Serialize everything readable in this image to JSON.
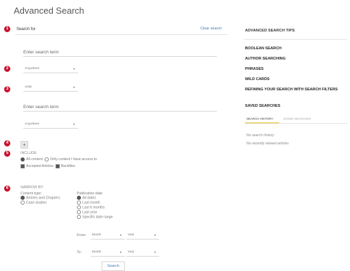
{
  "page": {
    "title": "Advanced Search"
  },
  "badges": [
    "1",
    "2",
    "3",
    "4",
    "5",
    "6"
  ],
  "search": {
    "search_for_label": "Search for",
    "clear_label": "Clear search",
    "term_placeholder": "Enter search term",
    "field_select": "Anywhere",
    "operator_select": "AND",
    "term2_placeholder": "Enter search term",
    "field2_select": "Anywhere"
  },
  "include": {
    "label": "INCLUDE:",
    "all_content": "All content",
    "only_access": "Only content I have access to",
    "accepted_articles": "Accepted Articles",
    "backfiles": "Backfiles"
  },
  "narrow": {
    "label": "NARROW BY:",
    "content_type_label": "Content type:",
    "content_types": [
      "Articles and Chapters",
      "Case studies"
    ],
    "pub_date_label": "Publication date:",
    "pub_dates": [
      "All dates",
      "Last month",
      "Last 6 months",
      "Last year",
      "Specific date range"
    ],
    "from_label": "From:",
    "to_label": "To:",
    "month": "Month",
    "year": "Year",
    "search_button": "Search"
  },
  "sidebar": {
    "title": "ADVANCED SEARCH TIPS",
    "items": [
      "BOOLEAN SEARCH",
      "AUTHOR SEARCHING",
      "PHRASES",
      "WILD CARDS",
      "REFINING YOUR SEARCH WITH SEARCH FILTERS",
      "SAVED SEARCHES"
    ],
    "tabs": [
      "SEARCH HISTORY",
      "SAVED SEARCHES"
    ],
    "no_history": "No search history",
    "no_viewed": "No recently viewed articles"
  },
  "colors": {
    "badge": "#c8102e",
    "link": "#3a7ab8",
    "tab_accent": "#e8c11c"
  }
}
